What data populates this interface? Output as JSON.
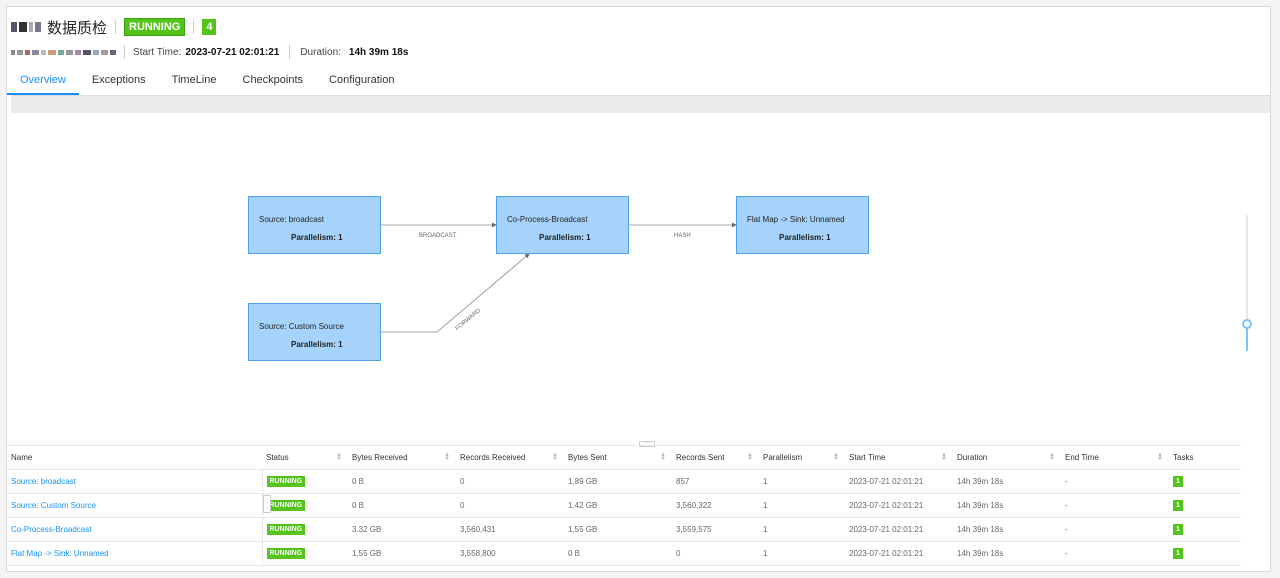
{
  "job": {
    "title": "数据质检",
    "status": "RUNNING",
    "task_count": "4",
    "start_time_label": "Start Time:",
    "start_time": "2023-07-21 02:01:21",
    "duration_label": "Duration:",
    "duration": "14h 39m 18s"
  },
  "tabs": [
    "Overview",
    "Exceptions",
    "TimeLine",
    "Checkpoints",
    "Configuration"
  ],
  "graph": {
    "nodes": [
      {
        "name": "Source: broadcast",
        "parallelism": "Parallelism: 1"
      },
      {
        "name": "Co-Process-Broadcast",
        "parallelism": "Parallelism: 1"
      },
      {
        "name": "Flat Map -> Sink: Unnamed",
        "parallelism": "Parallelism: 1"
      },
      {
        "name": "Source: Custom Source",
        "parallelism": "Parallelism: 1"
      }
    ],
    "edges": [
      "BROADCAST",
      "HASH",
      "FORWARD"
    ]
  },
  "table": {
    "headers": [
      "Name",
      "Status",
      "Bytes Received",
      "Records Received",
      "Bytes Sent",
      "Records Sent",
      "Parallelism",
      "Start Time",
      "Duration",
      "End Time",
      "Tasks"
    ],
    "rows": [
      [
        "Source: broadcast",
        "RUNNING",
        "0 B",
        "0",
        "1.89 GB",
        "857",
        "1",
        "2023-07-21 02:01:21",
        "14h 39m 18s",
        "-",
        "1"
      ],
      [
        "Source: Custom Source",
        "RUNNING",
        "0 B",
        "0",
        "1.42 GB",
        "3,560,322",
        "1",
        "2023-07-21 02:01:21",
        "14h 39m 18s",
        "-",
        "1"
      ],
      [
        "Co-Process-Broadcast",
        "RUNNING",
        "3.32 GB",
        "3,560,431",
        "1.55 GB",
        "3,559,575",
        "1",
        "2023-07-21 02:01:21",
        "14h 39m 18s",
        "-",
        "1"
      ],
      [
        "Flat Map -> Sink: Unnamed",
        "RUNNING",
        "1.55 GB",
        "3,558,800",
        "0 B",
        "0",
        "1",
        "2023-07-21 02:01:21",
        "14h 39m 18s",
        "-",
        "1"
      ]
    ]
  },
  "colors": {
    "accent": "#1890ff",
    "running": "#52c41a",
    "node_fill": "#a5d3fb"
  }
}
